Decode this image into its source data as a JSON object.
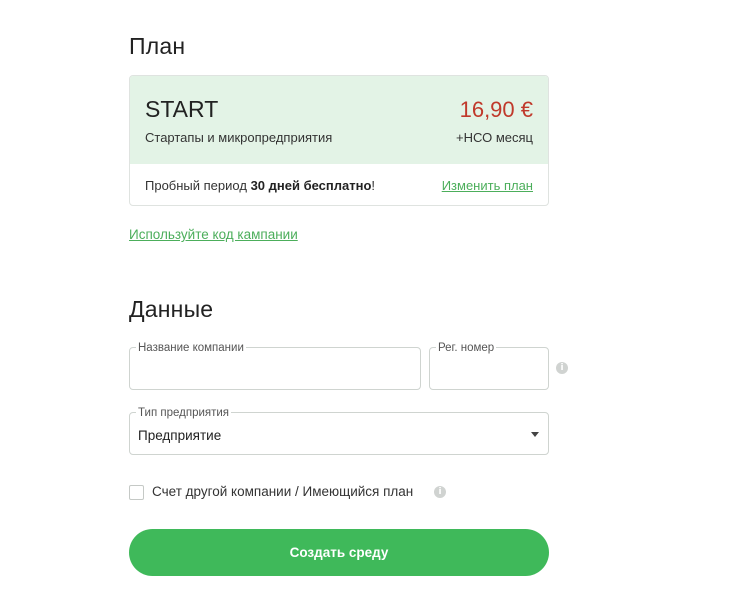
{
  "plan_section": {
    "title": "План",
    "plan": {
      "name": "START",
      "description": "Стартапы и микропредприятия",
      "price": "16,90 €",
      "period": "+НСО месяц"
    },
    "trial": {
      "prefix": "Пробный период ",
      "highlight": "30 дней бесплатно",
      "suffix": "!"
    },
    "change_plan_link": "Изменить план",
    "campaign_link": "Используйте код кампании"
  },
  "data_section": {
    "title": "Данные",
    "company_name": {
      "label": "Название компании",
      "value": ""
    },
    "reg_number": {
      "label": "Рег. номер",
      "value": ""
    },
    "enterprise_type": {
      "label": "Тип предприятия",
      "value": "Предприятие"
    },
    "other_company": {
      "label": "Счет другой компании / Имеющийся план",
      "checked": false
    },
    "info_icon": "i"
  },
  "submit_button": "Создать среду",
  "colors": {
    "accent": "#3fb95a",
    "plan_bg": "#e3f3e6",
    "price": "#c0392b",
    "link": "#4cae5b"
  }
}
